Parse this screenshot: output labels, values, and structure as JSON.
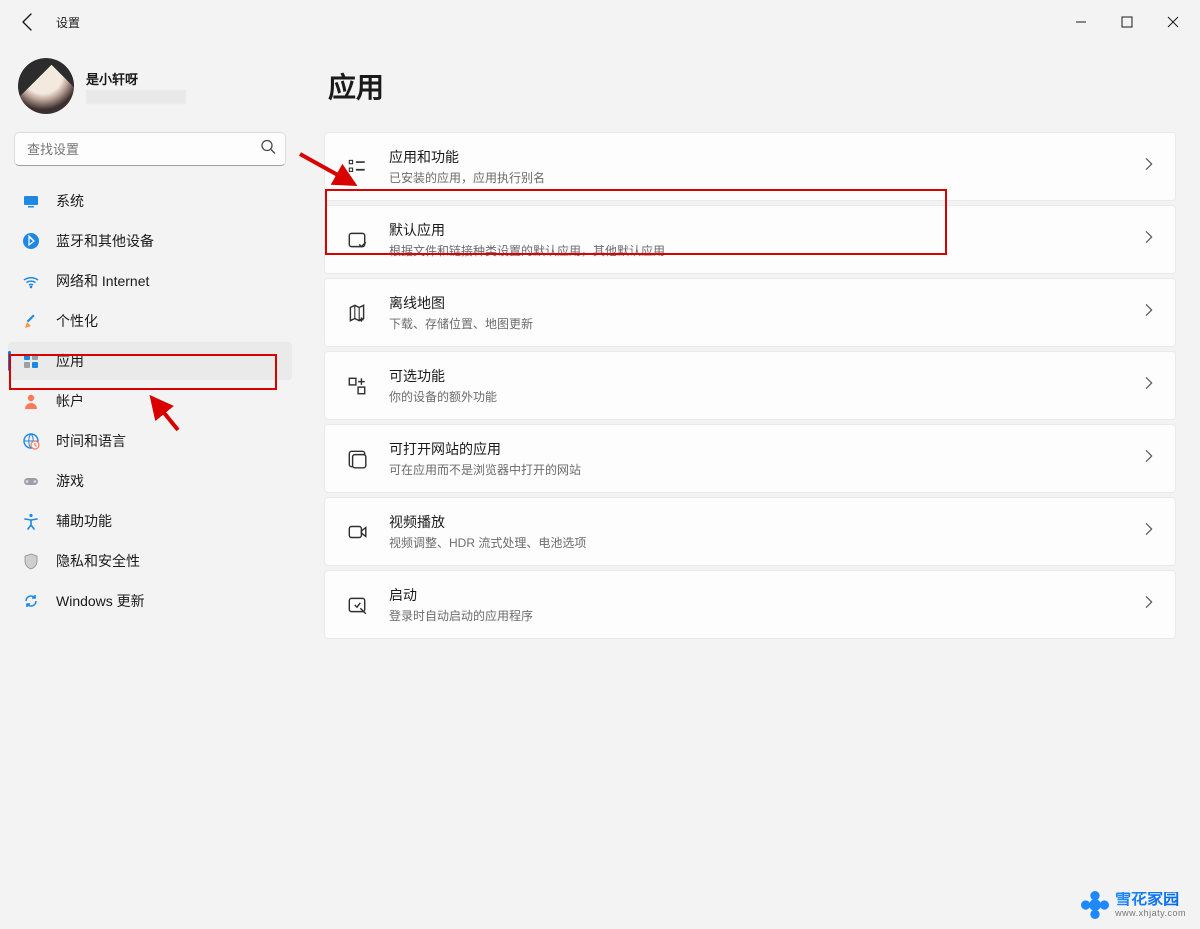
{
  "titlebar": {
    "app_title": "设置"
  },
  "profile": {
    "name": "是小轩呀"
  },
  "search": {
    "placeholder": "查找设置"
  },
  "sidebar": [
    {
      "key": "system",
      "label": "系统",
      "icon": "display"
    },
    {
      "key": "bluetooth",
      "label": "蓝牙和其他设备",
      "icon": "bluetooth"
    },
    {
      "key": "network",
      "label": "网络和 Internet",
      "icon": "wifi"
    },
    {
      "key": "personal",
      "label": "个性化",
      "icon": "brush"
    },
    {
      "key": "apps",
      "label": "应用",
      "icon": "apps",
      "selected": true
    },
    {
      "key": "accounts",
      "label": "帐户",
      "icon": "person"
    },
    {
      "key": "time",
      "label": "时间和语言",
      "icon": "globe-clock"
    },
    {
      "key": "gaming",
      "label": "游戏",
      "icon": "gamepad"
    },
    {
      "key": "accessibility",
      "label": "辅助功能",
      "icon": "accessibility"
    },
    {
      "key": "privacy",
      "label": "隐私和安全性",
      "icon": "shield"
    },
    {
      "key": "update",
      "label": "Windows 更新",
      "icon": "update"
    }
  ],
  "page": {
    "title": "应用"
  },
  "cards": [
    {
      "key": "apps-features",
      "icon": "list",
      "title": "应用和功能",
      "sub": "已安装的应用，应用执行别名"
    },
    {
      "key": "default-apps",
      "icon": "default",
      "title": "默认应用",
      "sub": "根据文件和链接种类设置的默认应用，其他默认应用",
      "highlighted": true
    },
    {
      "key": "offline-maps",
      "icon": "map",
      "title": "离线地图",
      "sub": "下载、存储位置、地图更新"
    },
    {
      "key": "optional",
      "icon": "optional",
      "title": "可选功能",
      "sub": "你的设备的额外功能"
    },
    {
      "key": "web-apps",
      "icon": "web",
      "title": "可打开网站的应用",
      "sub": "可在应用而不是浏览器中打开的网站"
    },
    {
      "key": "video",
      "icon": "video",
      "title": "视频播放",
      "sub": "视频调整、HDR 流式处理、电池选项"
    },
    {
      "key": "startup",
      "icon": "startup",
      "title": "启动",
      "sub": "登录时自动启动的应用程序"
    }
  ],
  "watermark": {
    "main": "雪花家园",
    "sub": "www.xhjaty.com"
  }
}
